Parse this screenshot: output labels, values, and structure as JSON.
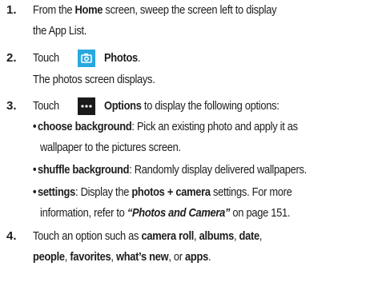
{
  "steps": [
    {
      "number": "1.",
      "line1_pre": "From the ",
      "line1_bold": "Home",
      "line1_post": " screen, sweep the screen left to display",
      "line2": "the App List."
    },
    {
      "number": "2.",
      "pre": "Touch",
      "icon": "photos-camera-icon",
      "bold": "Photos",
      "post": ".",
      "result": "The photos screen displays."
    },
    {
      "number": "3.",
      "pre": "Touch",
      "icon": "options-ellipsis-icon",
      "bold": "Options",
      "post": " to display the following options:",
      "options": [
        {
          "name": "choose background",
          "line1": ": Pick an existing photo and apply it as",
          "line2": "wallpaper to the pictures screen."
        },
        {
          "name": "shuffle background",
          "line1": ": Randomly display delivered wallpapers."
        },
        {
          "name": "settings",
          "line1_a": ": Display the ",
          "line1_b": "photos + camera",
          "line1_c": " settings. For more",
          "line2_a": "information, refer to ",
          "line2_ref": "“Photos and Camera”",
          "line2_b": "  on page 151."
        }
      ]
    },
    {
      "number": "4.",
      "line1_pre": "Touch an option such as ",
      "opt1": "camera roll",
      "sep1": ", ",
      "opt2": "albums",
      "sep2": ", ",
      "opt3": "date",
      "sep3": ",",
      "opt4": "people",
      "sep4": ", ",
      "opt5": "favorites",
      "sep5": ", ",
      "opt6": "what’s new",
      "sep6": ", or ",
      "opt7": "apps",
      "end": "."
    }
  ],
  "colors": {
    "photos_icon_bg": "#29a8e0",
    "options_icon_bg": "#1a1a1a",
    "text": "#1d1d1d"
  }
}
